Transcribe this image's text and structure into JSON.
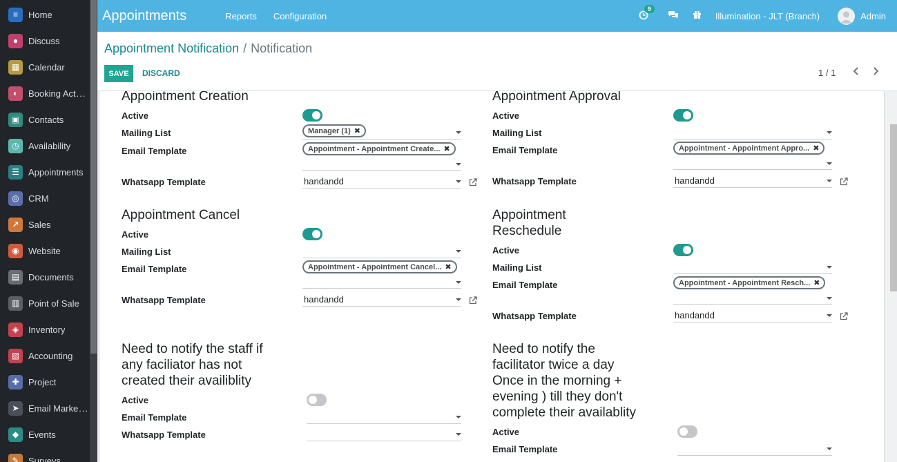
{
  "app": {
    "title": "Appointments"
  },
  "top_menu": [
    "Reports",
    "Configuration"
  ],
  "topbar": {
    "activity_badge": "9",
    "company": "Illumination - JLT (Branch)",
    "user": "Admin"
  },
  "sidebar": {
    "items": [
      {
        "label": "Home",
        "icon": "home-icon",
        "color": "#2a6dbd",
        "ellipsis": ""
      },
      {
        "label": "Discuss",
        "icon": "discuss-icon",
        "color": "#c23f6b",
        "ellipsis": ""
      },
      {
        "label": "Calendar",
        "icon": "calendar-icon",
        "color": "#b59a42",
        "ellipsis": ""
      },
      {
        "label": "Booking Act",
        "icon": "booking-icon",
        "color": "#c24e6a",
        "ellipsis": "..."
      },
      {
        "label": "Contacts",
        "icon": "contacts-icon",
        "color": "#2f8a7f",
        "ellipsis": ""
      },
      {
        "label": "Availability",
        "icon": "availability-icon",
        "color": "#5cb7ae",
        "ellipsis": ""
      },
      {
        "label": "Appointments",
        "icon": "appointments-icon",
        "color": "#2c7d84",
        "ellipsis": ""
      },
      {
        "label": "CRM",
        "icon": "crm-icon",
        "color": "#5b6dab",
        "ellipsis": ""
      },
      {
        "label": "Sales",
        "icon": "sales-icon",
        "color": "#d1773a",
        "ellipsis": ""
      },
      {
        "label": "Website",
        "icon": "website-icon",
        "color": "#d25a3c",
        "ellipsis": ""
      },
      {
        "label": "Documents",
        "icon": "documents-icon",
        "color": "#6a6d72",
        "ellipsis": ""
      },
      {
        "label": "Point of Sale",
        "icon": "pos-icon",
        "color": "#5c6066",
        "ellipsis": ""
      },
      {
        "label": "Inventory",
        "icon": "inventory-icon",
        "color": "#c2424f",
        "ellipsis": ""
      },
      {
        "label": "Accounting",
        "icon": "accounting-icon",
        "color": "#c2424f",
        "ellipsis": ""
      },
      {
        "label": "Project",
        "icon": "project-icon",
        "color": "#5a6ca8",
        "ellipsis": ""
      },
      {
        "label": "Email Marke",
        "icon": "email-marketing-icon",
        "color": "#4a5058",
        "ellipsis": "..."
      },
      {
        "label": "Events",
        "icon": "events-icon",
        "color": "#2b8c86",
        "ellipsis": ""
      },
      {
        "label": "Surveys",
        "icon": "surveys-icon",
        "color": "#c47a3a",
        "ellipsis": ""
      }
    ]
  },
  "breadcrumb": {
    "parent": "Appointment Notification",
    "separator": "/",
    "current": "Notification"
  },
  "buttons": {
    "save": "SAVE",
    "discard": "DISCARD"
  },
  "pager": {
    "value": "1 / 1"
  },
  "labels": {
    "active": "Active",
    "mailing_list": "Mailing List",
    "email_template": "Email Template",
    "whatsapp_template": "Whatsapp Template"
  },
  "sections": {
    "creation": {
      "title": "Appointment Creation",
      "active": true,
      "mailing_tag": "Manager (1)",
      "email_tag": "Appointment - Appointment Create...",
      "whatsapp": "handandd"
    },
    "approval": {
      "title": "Appointment Approval",
      "active": true,
      "mailing_tag": "",
      "email_tag": "Appointment - Appointment Appro...",
      "whatsapp": "handandd"
    },
    "cancel": {
      "title": "Appointment Cancel",
      "active": true,
      "mailing_tag": "",
      "email_tag": "Appointment - Appointment Cancel...",
      "whatsapp": "handandd"
    },
    "reschedule": {
      "title_line1": "Appointment",
      "title_line2": "Reschedule",
      "active": true,
      "mailing_tag": "",
      "email_tag": "Appointment - Appointment Resch...",
      "whatsapp": "handandd"
    },
    "staff_notify": {
      "title_lines": [
        "Need to notify the staff if",
        "any faciliator has not",
        "created their availiblity"
      ],
      "active": false,
      "email": "",
      "whatsapp": ""
    },
    "facilitator_notify": {
      "title_lines": [
        "Need to notify the",
        "facilitator twice a day",
        "Once in the morning +",
        "evening ) till they don't",
        "complete their availablity"
      ],
      "active": false,
      "email": ""
    }
  }
}
